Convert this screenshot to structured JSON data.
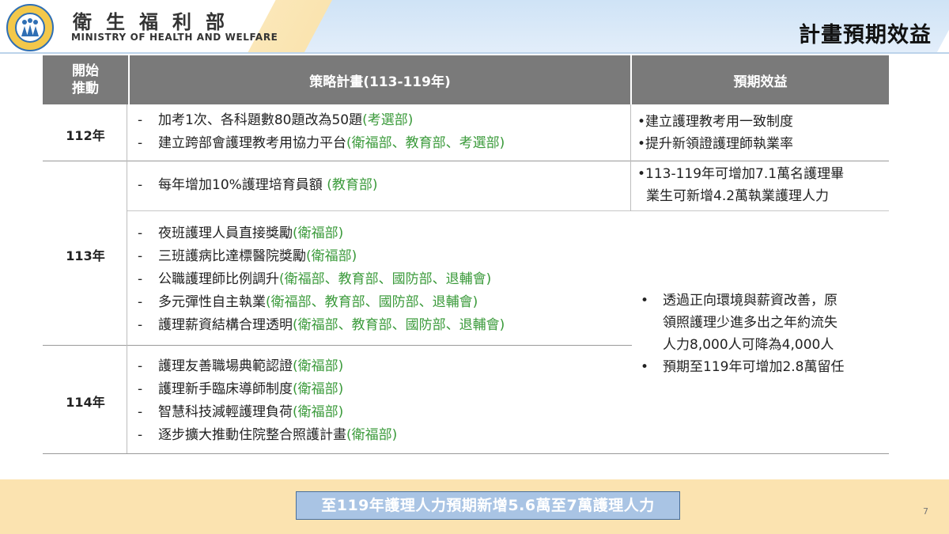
{
  "header": {
    "org_name_zh": "衛生福利部",
    "org_name_en": "MINISTRY OF HEALTH AND WELFARE",
    "page_title": "計畫預期效益",
    "logo_icon": "ministry-emblem-icon"
  },
  "table": {
    "columns": [
      "開始\n推動",
      "策略計畫(113-119年)",
      "預期效益"
    ],
    "rows": {
      "y112": {
        "year": "112年",
        "items": [
          {
            "text": "加考1次、各科題數80題改為50題",
            "agency": "(考選部)"
          },
          {
            "text": "建立跨部會護理教考用協力平台",
            "agency": "(衛福部、教育部、考選部)"
          }
        ],
        "benefits": [
          "•建立護理教考用一致制度",
          "•提升新領證護理師執業率"
        ]
      },
      "y113": {
        "year": "113年",
        "group_a": [
          {
            "text": "每年增加10%護理培育員額 ",
            "agency": "(教育部)"
          }
        ],
        "benefit_a": [
          "•113-119年可增加7.1萬名護理畢",
          "業生可新增4.2萬執業護理人力"
        ],
        "group_b": [
          {
            "text": "夜班護理人員直接獎勵",
            "agency": "(衛福部)"
          },
          {
            "text": "三班護病比達標醫院獎勵",
            "agency": "(衛福部)"
          },
          {
            "text": "公職護理師比例調升",
            "agency": "(衛福部、教育部、國防部、退輔會)"
          },
          {
            "text": "多元彈性自主執業",
            "agency": "(衛福部、教育部、國防部、退輔會)"
          },
          {
            "text": "護理薪資結構合理透明",
            "agency": "(衛福部、教育部、國防部、退輔會)"
          }
        ]
      },
      "y114": {
        "year": "114年",
        "items": [
          {
            "text": "護理友善職場典範認證",
            "agency": "(衛福部)"
          },
          {
            "text": "護理新手臨床導師制度",
            "agency": "(衛福部)"
          },
          {
            "text": "智慧科技減輕護理負荷",
            "agency": "(衛福部)"
          },
          {
            "text": "逐步擴大推動住院整合照護計畫",
            "agency": "(衛福部)"
          }
        ]
      }
    },
    "shared_benefits": [
      {
        "bullet": "•",
        "lines": [
          "透過正向環境與薪資改善，原",
          "領照護理少進多出之年約流失",
          "人力8,000人可降為4,000人"
        ]
      },
      {
        "bullet": "•",
        "lines": [
          "預期至119年可增加2.8萬留任"
        ]
      }
    ],
    "dash": "-"
  },
  "footer": {
    "summary": "至119年護理人力預期新增5.6萬至7萬護理人力",
    "page_number": "7"
  },
  "colors": {
    "header_gray": "#7a7a7a",
    "agency_green": "#3a9a3a",
    "summary_blue": "#a9c4e4",
    "footer_band": "#fbe3b0"
  }
}
